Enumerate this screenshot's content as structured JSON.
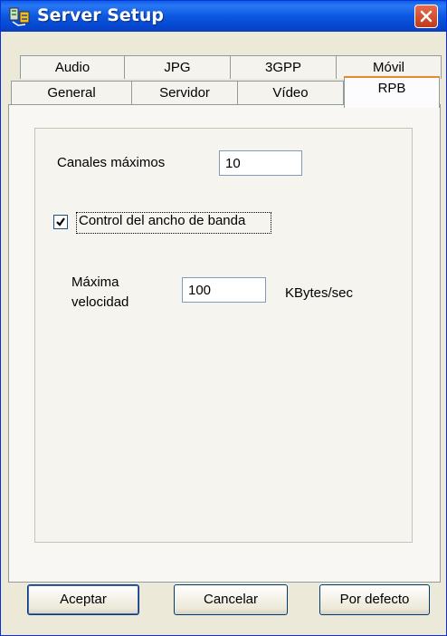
{
  "window": {
    "title": "Server Setup"
  },
  "tabs": {
    "row1": [
      "Audio",
      "JPG",
      "3GPP",
      "Móvil"
    ],
    "row2": [
      "General",
      "Servidor",
      "Vídeo",
      "RPB"
    ],
    "active": "RPB"
  },
  "form": {
    "max_channels_label": "Canales máximos",
    "max_channels_value": "10",
    "bandwidth_checkbox_label": "Control del ancho de banda",
    "bandwidth_checked": true,
    "max_speed_label_line1": "Máxima",
    "max_speed_label_line2": "velocidad",
    "max_speed_value": "100",
    "max_speed_unit": "KBytes/sec"
  },
  "buttons": {
    "accept": "Aceptar",
    "cancel": "Cancelar",
    "default": "Por defecto"
  },
  "colors": {
    "titlebar": "#0a5fe8",
    "active_tab_accent": "#e68b2c",
    "dialog_bg": "#ece9d8"
  }
}
